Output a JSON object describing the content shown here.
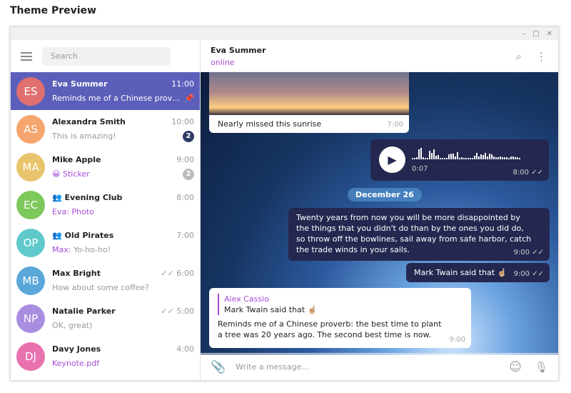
{
  "page_title": "Theme Preview",
  "window_controls": {
    "minimize": "–",
    "maximize": "□",
    "close": "✕"
  },
  "sidebar": {
    "search_placeholder": "Search",
    "chats": [
      {
        "initials": "ES",
        "name": "Eva Summer",
        "time": "11:00",
        "preview": "Reminds me of a Chinese prover...",
        "color": "#e07070",
        "pinned": true,
        "selected": true
      },
      {
        "initials": "AS",
        "name": "Alexandra Smith",
        "time": "10:00",
        "preview": "This is amazing!",
        "color": "#f5a56e",
        "badge": "2",
        "badge_color": "#2c3a66"
      },
      {
        "initials": "MA",
        "name": "Mike Apple",
        "time": "9:00",
        "preview": "😀 Sticker",
        "color": "#e8c46c",
        "badge": "2",
        "badge_color": "#bbbbbb",
        "accent": true
      },
      {
        "initials": "EC",
        "name": "Evening Club",
        "time": "8:00",
        "preview": "Eva: Photo",
        "color": "#7dc85a",
        "group": true,
        "accent": true
      },
      {
        "initials": "OP",
        "name": "Old Pirates",
        "time": "7:00",
        "sender": "Max:",
        "preview": "Yo-ho-ho!",
        "color": "#5fc9cc",
        "group": true
      },
      {
        "initials": "MB",
        "name": "Max Bright",
        "time": "6:00",
        "preview": "How about some coffee?",
        "color": "#5aa7d9",
        "read": true
      },
      {
        "initials": "NP",
        "name": "Natalie Parker",
        "time": "5:00",
        "preview": "OK, great)",
        "color": "#a88de0",
        "read": true
      },
      {
        "initials": "DJ",
        "name": "Davy Jones",
        "time": "4:00",
        "preview": "Keynote.pdf",
        "color": "#e872ae",
        "accent": true
      }
    ]
  },
  "chat": {
    "name": "Eva Summer",
    "status": "online",
    "messages": {
      "photo_caption": "Nearly missed this sunrise",
      "photo_time": "7:00",
      "voice_duration": "0:07",
      "voice_time": "8:00",
      "date": "December 26",
      "long_text": "Twenty years from now you will be more disappointed by the things that you didn't do than by the ones you did do, so throw off the bowlines, sail away from safe harbor, catch the trade winds in your sails.",
      "long_time": "9:00",
      "short_text": "Mark Twain said that ☝🏼",
      "short_time": "9:00",
      "reply_author": "Alex Cassio",
      "reply_quote": "Mark Twain said that ☝🏼",
      "reply_text": "Reminds me of a Chinese proverb: the best time to plant a tree was 20 years ago. The second best time is now.",
      "reply_time": "9:00"
    }
  },
  "composer": {
    "placeholder": "Write a message..."
  },
  "colors": {
    "accent": "#a64bd6",
    "selected": "#5c5fb9",
    "outgoing_bubble": "#242850"
  }
}
